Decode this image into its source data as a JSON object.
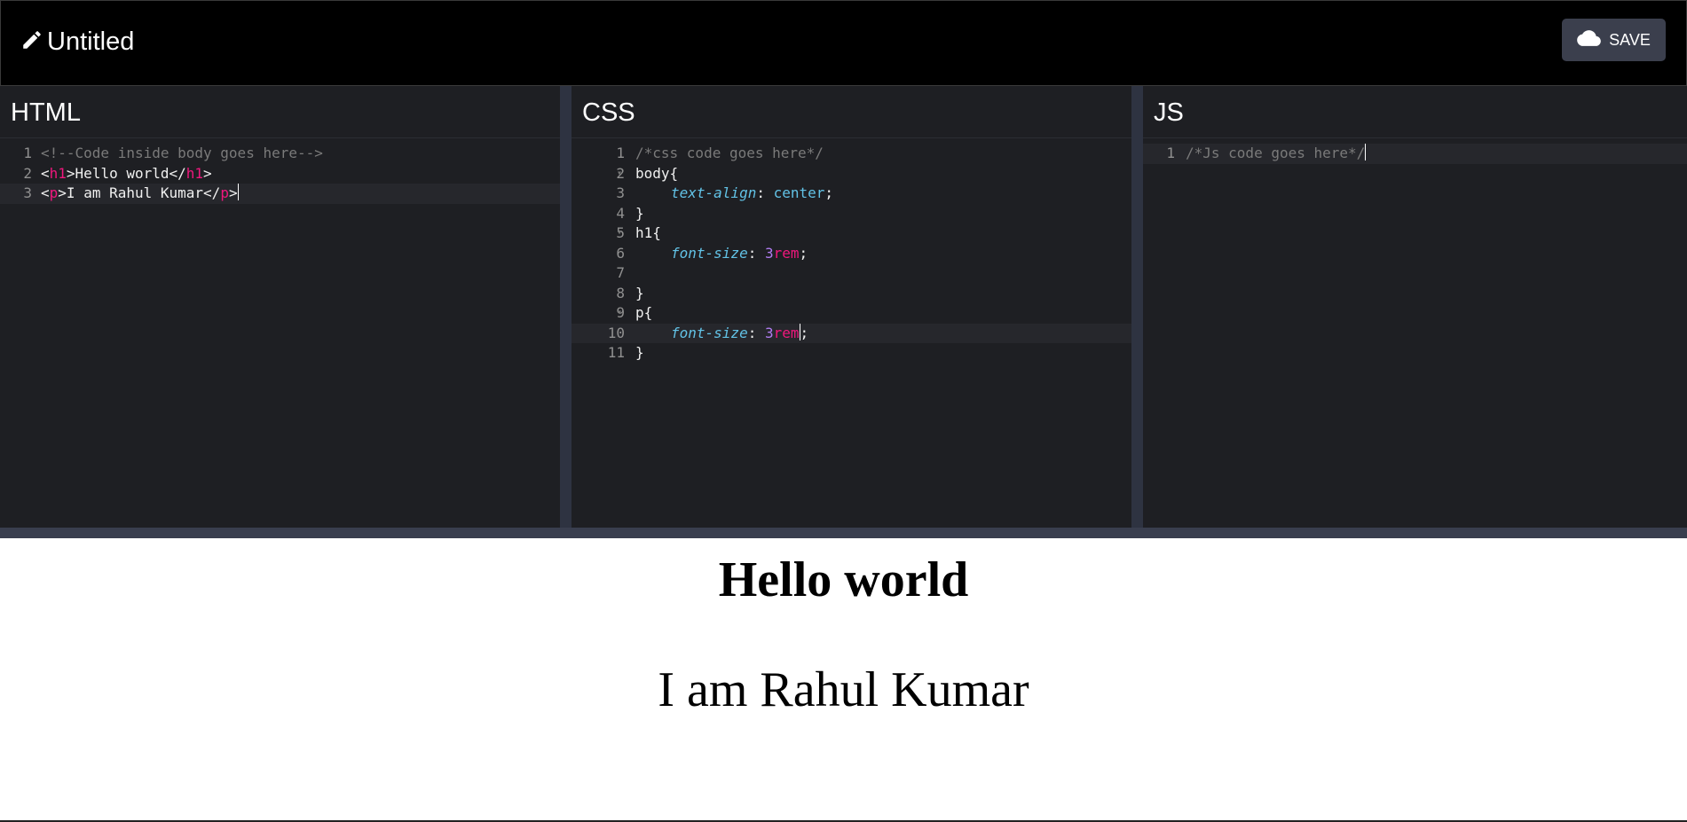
{
  "header": {
    "title": "Untitled",
    "save_label": "SAVE",
    "icons": {
      "title_icon": "pencil-icon",
      "save_icon": "cloud-icon"
    }
  },
  "panes": {
    "html": {
      "title": "HTML",
      "numbers": [
        "1",
        "2",
        "3"
      ],
      "lines": [
        {
          "comment": "<!--Code inside body goes here-->"
        },
        {
          "open": "<",
          "tag1": "h1",
          "gt1": ">",
          "text": "Hello world",
          "close": "</",
          "tag2": "h1",
          "gt2": ">"
        },
        {
          "open": "<",
          "tag1": "p",
          "gt1": ">",
          "text": "I am Rahul Kumar",
          "close": "</",
          "tag2": "p",
          "gt2": ">"
        }
      ]
    },
    "css": {
      "title": "CSS",
      "numbers": [
        "1",
        "2",
        "3",
        "4",
        "5",
        "6",
        "7",
        "8",
        "9",
        "10",
        "11"
      ],
      "lines": {
        "l1": "/*css code goes here*/",
        "l2": "body{",
        "l3_prop": "text-align",
        "l3_colon": ": ",
        "l3_val": "center",
        "l3_semi": ";",
        "l4": "}",
        "l5": "h1{",
        "l6_prop": "font-size",
        "l6_colon": ": ",
        "l6_num": "3",
        "l6_unit": "rem",
        "l6_semi": ";",
        "l8": "}",
        "l9": "p{",
        "l10_prop": "font-size",
        "l10_colon": ": ",
        "l10_num": "3",
        "l10_unit": "rem",
        "l10_semi": ";",
        "l11": "}"
      }
    },
    "js": {
      "title": "JS",
      "numbers": [
        "1"
      ],
      "lines": {
        "l1": "/*Js code goes here*/"
      }
    }
  },
  "preview": {
    "heading": "Hello world",
    "paragraph": "I am Rahul Kumar"
  },
  "colors": {
    "topbar": "#000000",
    "editor_bg": "#1e1f23",
    "tag": "#f0177d",
    "property": "#62c2e6",
    "number": "#b07cf0",
    "comment": "#7a7a7a"
  }
}
